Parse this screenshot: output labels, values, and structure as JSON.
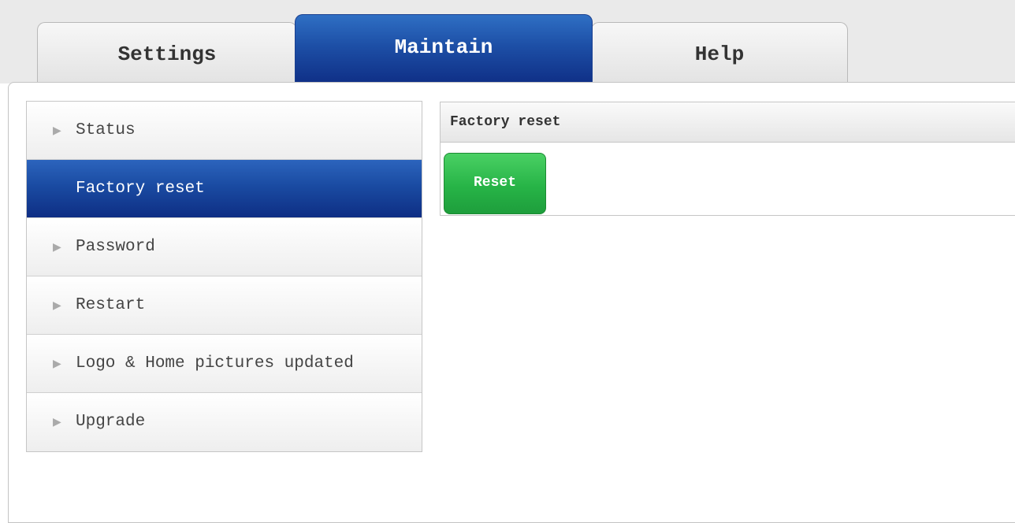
{
  "tabs": [
    {
      "label": "Settings",
      "active": false
    },
    {
      "label": "Maintain",
      "active": true
    },
    {
      "label": "Help",
      "active": false
    }
  ],
  "sidebar": {
    "items": [
      {
        "label": "Status",
        "icon": "triangle-right-icon",
        "active": false
      },
      {
        "label": "Factory reset",
        "icon": "",
        "active": true
      },
      {
        "label": "Password",
        "icon": "triangle-right-icon",
        "active": false
      },
      {
        "label": "Restart",
        "icon": "triangle-right-icon",
        "active": false
      },
      {
        "label": "Logo & Home pictures updated",
        "icon": "triangle-right-icon",
        "active": false
      },
      {
        "label": "Upgrade",
        "icon": "triangle-right-icon",
        "active": false
      }
    ]
  },
  "content": {
    "title": "Factory reset",
    "reset_label": "Reset"
  },
  "colors": {
    "active_blue": "#1a4ba2",
    "reset_green": "#27b447"
  }
}
